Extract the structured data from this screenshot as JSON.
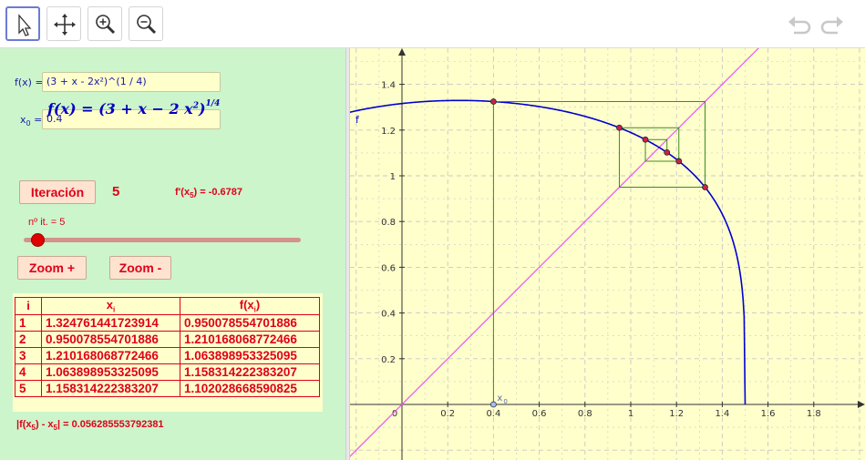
{
  "toolbar": {
    "tools": [
      {
        "name": "move",
        "icon": "arrow-pointer-icon",
        "active": true
      },
      {
        "name": "move-graphics-view",
        "icon": "move-cross-icon",
        "active": false
      },
      {
        "name": "zoom-in",
        "icon": "zoom-in-icon",
        "active": false
      },
      {
        "name": "zoom-out",
        "icon": "zoom-out-icon",
        "active": false
      }
    ],
    "undo_icon": "undo-icon",
    "redo_icon": "redo-icon"
  },
  "algebra": {
    "f_label": "f(x) =",
    "f_value": "(3 + x - 2x²)^(1 / 4)",
    "x0_label": "x",
    "x0_label_sub": "0",
    "x0_label_eq": " =",
    "x0_value": "0.4",
    "formula_left": "f(x) = (3 + x − 2 x",
    "formula_exp2": "2",
    "formula_close": ")",
    "formula_exp": "1/4",
    "iter_button": "Iteración",
    "iter_count": "5",
    "deriv_prefix": "f'(x",
    "deriv_sub": "5",
    "deriv_suffix": ") = -0.6787",
    "slider_label": "nº it. = 5",
    "slider_value": 5,
    "zoom_plus": "Zoom +",
    "zoom_minus": "Zoom -",
    "error_prefix": "|f(x",
    "error_sub1": "5",
    "error_mid": ") - x",
    "error_sub2": "5",
    "error_suffix": "| = 0.056285553792381"
  },
  "table": {
    "headers": [
      "i",
      "x",
      "f(x",
      ")"
    ],
    "header_sub": "i",
    "rows": [
      [
        "1",
        "1.324761441723914",
        "0.950078554701886"
      ],
      [
        "2",
        "0.950078554701886",
        "1.210168068772466"
      ],
      [
        "3",
        "1.210168068772466",
        "1.063898953325095"
      ],
      [
        "4",
        "1.063898953325095",
        "1.158314222383207"
      ],
      [
        "5",
        "1.158314222383207",
        "1.102028668590825"
      ]
    ]
  },
  "graph": {
    "function_label": "f",
    "x0_point_label": "x",
    "x0_point_sub": "0",
    "origin_label": "0",
    "x_ticks": [
      "0.2",
      "0.4",
      "0.6",
      "0.8",
      "1",
      "1.2",
      "1.4",
      "1.6",
      "1.8"
    ],
    "y_ticks": [
      "0.2",
      "0.4",
      "0.6",
      "0.8",
      "1",
      "1.2",
      "1.4"
    ],
    "colors": {
      "background": "#ffffcc",
      "curve": "#0000d0",
      "diagonal": "#ee55ee",
      "cobweb": "#3c8c1e",
      "points": "#cc2244"
    },
    "x0": 0.4,
    "iterates": [
      0.4,
      1.324761441723914,
      0.950078554701886,
      1.210168068772466,
      1.063898953325095,
      1.158314222383207,
      1.102028668590825
    ]
  }
}
